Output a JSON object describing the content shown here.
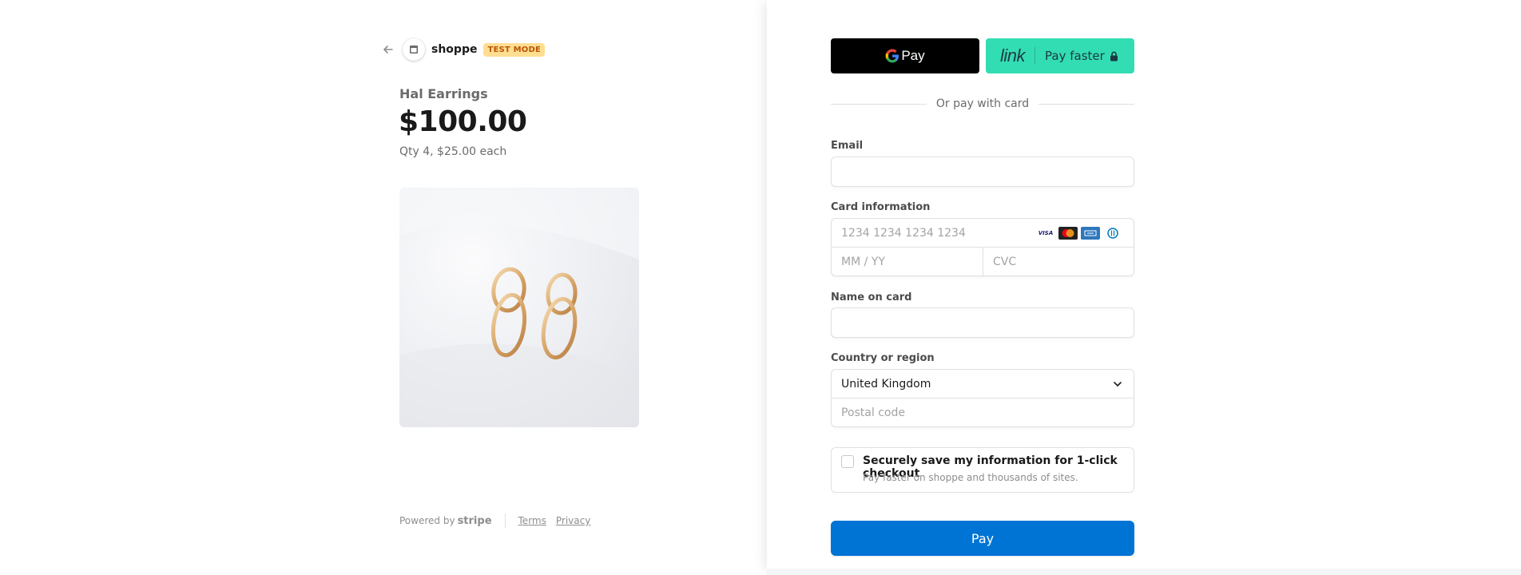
{
  "merchant": {
    "name": "shoppe",
    "badge": "TEST MODE"
  },
  "product": {
    "name": "Hal Earrings",
    "price": "$100.00",
    "quantity_text": "Qty 4, $25.00 each"
  },
  "footer": {
    "powered_by": "Powered by",
    "stripe": "stripe",
    "terms": "Terms",
    "privacy": "Privacy"
  },
  "wallets": {
    "gpay_label": "Pay",
    "link_logo": "link",
    "link_label": "Pay faster"
  },
  "divider_text": "Or pay with card",
  "form": {
    "email_label": "Email",
    "email_value": "",
    "card_label": "Card information",
    "card_number_placeholder": "1234 1234 1234 1234",
    "expiry_placeholder": "MM / YY",
    "cvc_placeholder": "CVC",
    "card_brands": [
      "VISA",
      "mastercard-icon",
      "amex-icon",
      "diners-icon"
    ],
    "name_label": "Name on card",
    "name_value": "",
    "country_label": "Country or region",
    "country_value": "United Kingdom",
    "postal_placeholder": "Postal code"
  },
  "save_info": {
    "title": "Securely save my information for 1-click checkout",
    "subtitle": "Pay faster on shoppe and thousands of sites.",
    "checked": false
  },
  "pay_button": "Pay",
  "colors": {
    "pay_blue": "#0074d4",
    "link_green": "#33ddb3",
    "test_badge_bg": "#ffde92",
    "test_badge_text": "#bb5504"
  }
}
